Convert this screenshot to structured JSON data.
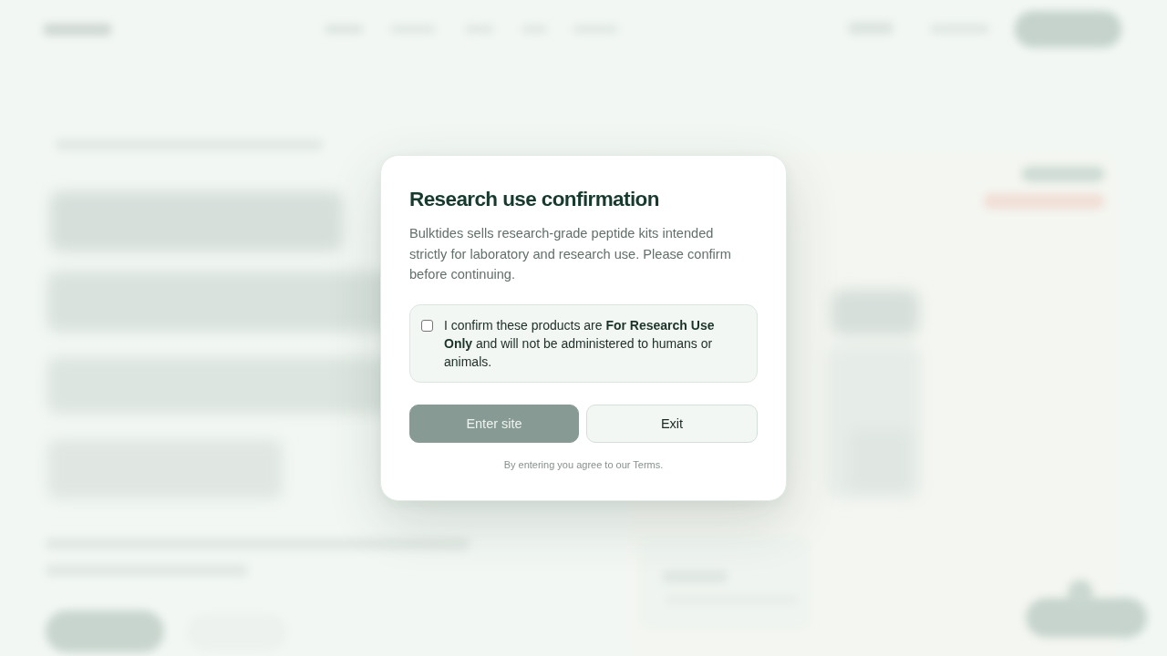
{
  "dialog": {
    "title": "Research use confirmation",
    "message": "Bulktides sells research-grade peptide kits intended strictly for laboratory and research use. Please confirm before continuing.",
    "confirmation": {
      "label": "I confirm these products are **For Research Use Only** and will not be administered to humans or animals.",
      "checked": false
    },
    "buttons": [
      {
        "label": "Enter site",
        "kind": "primary",
        "disabled": true
      },
      {
        "label": "Exit",
        "kind": "secondary",
        "disabled": false
      }
    ],
    "footnote": "By entering you agree to our Terms."
  }
}
